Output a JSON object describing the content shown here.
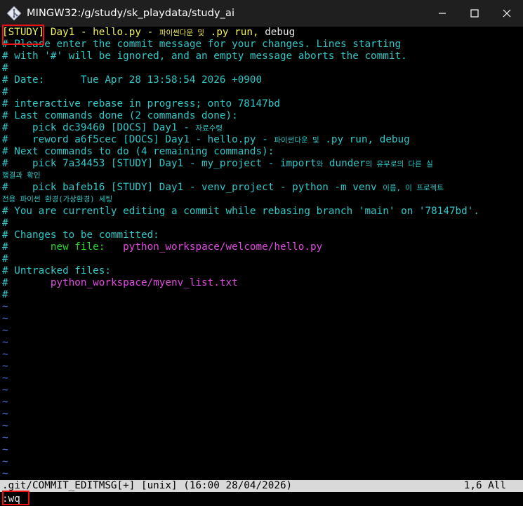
{
  "window": {
    "title": "MINGW32:/g/study/sk_playdata/study_ai",
    "controls": [
      "minimize",
      "maximize",
      "close"
    ]
  },
  "editor": {
    "line1": {
      "tag": "[STUDY]",
      "text1": " Day1 - hello.py - ",
      "ko1": "파이썬다운 및",
      "text2": " .py run, ",
      "text3": "debug"
    },
    "comment_lines": [
      "# Please enter the commit message for your changes. Lines starting",
      "# with '#' will be ignored, and an empty message aborts the commit.",
      "#",
      "# Date:      Tue Apr 28 13:58:54 2026 +0900",
      "#",
      "# interactive rebase in progress; onto 78147bd",
      "# Last commands done (2 commands done):"
    ],
    "pick1": {
      "prefix": "#    pick dc39460 [DOCS] Day1 - ",
      "ko": "자료수령"
    },
    "reword": {
      "prefix": "#    reword a6f5cec [DOCS] Day1 - hello.py - ",
      "ko": "파이썬다운 및",
      "suffix": " .py run, debug"
    },
    "next_header": "# Next commands to do (4 remaining commands):",
    "pick2": {
      "prefix": "#    pick 7a34453 [STUDY] Day1 - my_project - import",
      "ko1": "와",
      "mid": " dunder",
      "ko2": "의 유무로의 다른 실"
    },
    "pick2_wrap": "행결과 확인",
    "pick3": {
      "prefix": "#    pick bafeb16 [STUDY] Day1 - venv_project - python -m venv ",
      "ko": "이름, 이 프로젝트"
    },
    "pick3_wrap": "전용 파이썬 환경(가상환경) 세팅",
    "rebasing_line": "# You are currently editing a commit while rebasing branch 'main' on '78147bd'.",
    "hash_line": "#",
    "changes_header": "# Changes to be committed:",
    "changes_hash": "#",
    "new_file_label": "new file:",
    "new_file_path": "python_workspace/welcome/hello.py",
    "untracked_header": "# Untracked files:",
    "untracked_path": "python_workspace/myenv_list.txt",
    "tilde": "~"
  },
  "statusbar": {
    "left": ".git/COMMIT_EDITMSG[+] [unix] (16:00 28/04/2026)",
    "right": "1,6 All"
  },
  "command_line": ":wq",
  "colors": {
    "comment": "#2fc7c7",
    "subject": "#f2f25a",
    "new_file": "#29d429",
    "path": "#e04ae0",
    "tilde": "#4d6fd9",
    "highlight_box": "#ee1111"
  }
}
